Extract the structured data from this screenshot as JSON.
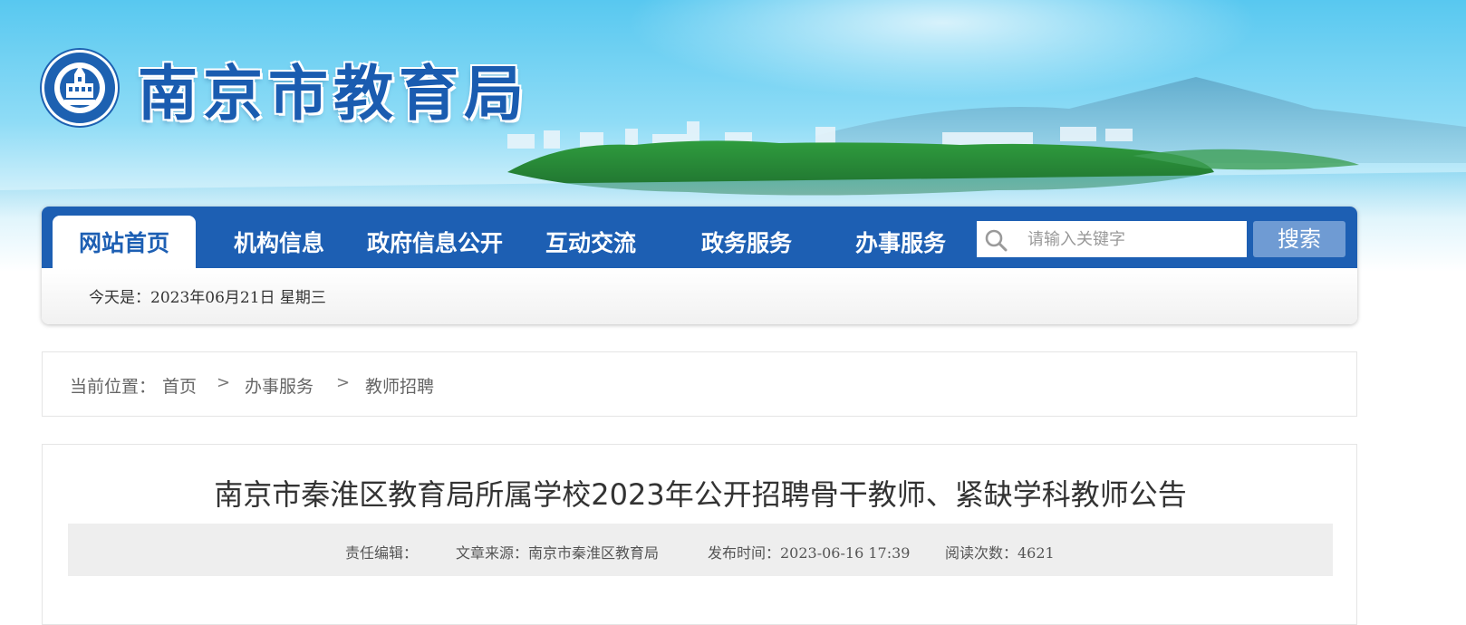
{
  "header": {
    "site_title": "南京市教育局",
    "logo_icon": "nanjing-education-emblem"
  },
  "nav": {
    "items": [
      {
        "label": "网站首页",
        "active": true
      },
      {
        "label": "机构信息",
        "active": false
      },
      {
        "label": "政府信息公开",
        "active": false
      },
      {
        "label": "互动交流",
        "active": false
      },
      {
        "label": "政务服务",
        "active": false
      },
      {
        "label": "办事服务",
        "active": false
      }
    ],
    "search": {
      "placeholder": "请输入关键字",
      "value": "",
      "button_label": "搜索",
      "icon": "search-icon"
    }
  },
  "date_bar": {
    "text": "今天是：2023年06月21日  星期三"
  },
  "breadcrumb": {
    "label": "当前位置：",
    "items": [
      "首页",
      "办事服务",
      "教师招聘"
    ],
    "separator": ">"
  },
  "article": {
    "title": "南京市秦淮区教育局所属学校2023年公开招聘骨干教师、紧缺学科教师公告",
    "meta": {
      "editor": "责任编辑：",
      "source": "文章来源：南京市秦淮区教育局",
      "published": "发布时间：2023-06-16 17:39",
      "views": "阅读次数：4621"
    }
  },
  "colors": {
    "nav_blue": "#1d5fb3",
    "search_button": "#6f9bd3",
    "sky": "#58c8f0",
    "meta_bg": "#eeeeee"
  }
}
